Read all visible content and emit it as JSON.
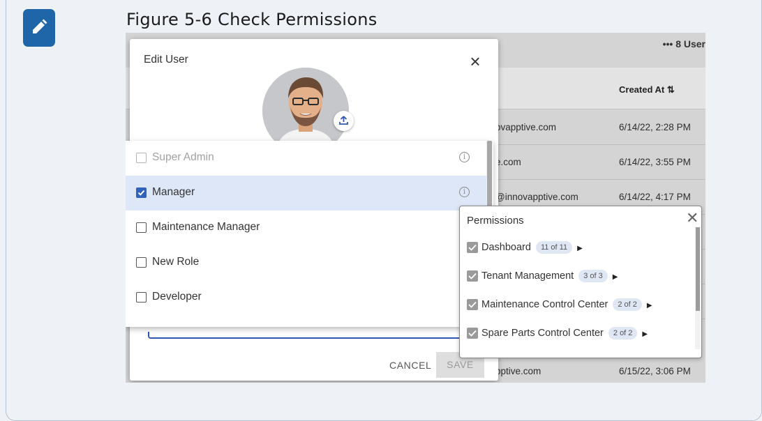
{
  "figure": {
    "title": "Figure 5-6 Check Permissions",
    "icon": "pencil-icon"
  },
  "background_table": {
    "more_label": "•••  8  User",
    "created_header": "Created At ⇅",
    "rows": [
      {
        "email": "ovapptive.com",
        "created": "6/14/22, 2:28 PM"
      },
      {
        "email": "e.com",
        "created": "6/14/22, 3:55 PM"
      },
      {
        "email": "@innovapptive.com",
        "created": "6/14/22, 4:17 PM"
      },
      {
        "email": "",
        "created": ""
      },
      {
        "email": "",
        "created": ""
      },
      {
        "email": "",
        "created": ""
      },
      {
        "email": "pptive.com",
        "created": "6/15/22, 3:06 PM"
      }
    ]
  },
  "dialog": {
    "title": "Edit User",
    "close_icon": "close-icon",
    "avatar_icon": "user-avatar",
    "upload_icon": "upload-icon",
    "cancel_label": "CANCEL",
    "save_label": "SAVE"
  },
  "roles": [
    {
      "label": "Super Admin",
      "checked": false,
      "disabled": true,
      "info": true
    },
    {
      "label": "Manager",
      "checked": true,
      "disabled": false,
      "info": true,
      "selected": true
    },
    {
      "label": "Maintenance Manager",
      "checked": false,
      "disabled": false,
      "info": false
    },
    {
      "label": "New Role",
      "checked": false,
      "disabled": false,
      "info": false
    },
    {
      "label": "Developer",
      "checked": false,
      "disabled": false,
      "info": false
    }
  ],
  "permissions": {
    "title": "Permissions",
    "close_label": "✕",
    "items": [
      {
        "label": "Dashboard",
        "count": "11 of 11"
      },
      {
        "label": "Tenant Management",
        "count": "3 of 3"
      },
      {
        "label": "Maintenance Control Center",
        "count": "2 of 2"
      },
      {
        "label": "Spare Parts Control Center",
        "count": "2 of 2"
      }
    ]
  },
  "colors": {
    "accent": "#1f66a8",
    "checkbox_blue": "#2f62b8",
    "selected_row": "#dde7f7"
  }
}
